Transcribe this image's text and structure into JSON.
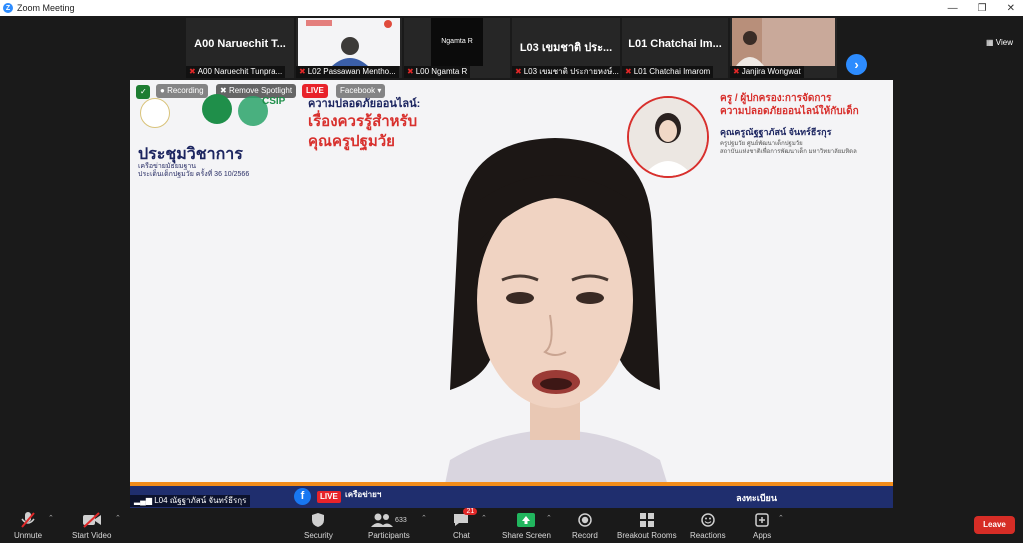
{
  "window": {
    "title": "Zoom Meeting",
    "min": "—",
    "restore": "❐",
    "close": "✕"
  },
  "view_label": "View",
  "gallery": [
    {
      "big": "A00 Naruechit T...",
      "cap": "A00 Naruechit Tunpra...",
      "muted": true
    },
    {
      "big": "",
      "cap": "L02 Passawan Mentho...",
      "muted": true
    },
    {
      "big": "",
      "cap": "L00 Ngamta R",
      "muted": true,
      "inner": "Ngamta R"
    },
    {
      "big": "L03 เขมชาติ ประ...",
      "cap": "L03 เขมชาติ ประกายหงษ์...",
      "muted": true
    },
    {
      "big": "L01 Chatchai Im...",
      "cap": "L01 Chatchai Imarom",
      "muted": true
    },
    {
      "big": "",
      "cap": "Janjira Wongwat",
      "muted": true
    }
  ],
  "stage": {
    "live_chip": "LIVE",
    "facebook_chip": "Facebook",
    "remove_spotlight": "Remove Spotlight",
    "recording_chip": "Recording",
    "org_csip": "CSIP",
    "title_th": "ประชุมวิชาการ",
    "sub1": "เครือข่ายมัธยมฐาน",
    "sub2": "ประเด็นเด็กปฐมวัย ครั้งที่ 36 10/2566",
    "banner_topic": "ความปลอดภัยออนไลน์:",
    "banner_main_1": "เรื่องควรรู้สำหรับ",
    "banner_main_2": "คุณครูปฐมวัย",
    "speaker_role_1": "ครู / ผู้ปกครอง:การจัดการ",
    "speaker_role_2": "ความปลอดภัยออนไลน์ให้กับเด็ก",
    "speaker_name": "คุณครูณัฐฐาภัสน์ จันทร์ธีรกุร",
    "speaker_aff1": "ครูปฐมวัย ศูนย์พัฒนาเด็กปฐมวัย",
    "speaker_aff2": "สถาบันแห่งชาติเพื่อการพัฒนาเด็ก มหาวิทยาลัยมหิดล",
    "footer_live": "LIVE",
    "footer_text": "เครือข่ายฯ",
    "footer_right": "ลงทะเบียน"
  },
  "speaker_tag": "L04 ณัฐฐาภัสน์ จันทร์ธีรกุร",
  "toolbar": {
    "unmute": "Unmute",
    "start_video": "Start Video",
    "security": "Security",
    "participants": "Participants",
    "participants_count": "633",
    "chat": "Chat",
    "chat_badge": "21",
    "share_screen": "Share Screen",
    "record": "Record",
    "breakout_rooms": "Breakout Rooms",
    "reactions": "Reactions",
    "apps": "Apps",
    "leave": "Leave"
  },
  "colors": {
    "zoom_blue": "#2d8cff",
    "share_green": "#21b65e",
    "leave_red": "#d62d26",
    "banner_red": "#d8302d",
    "banner_navy": "#1c2560"
  }
}
